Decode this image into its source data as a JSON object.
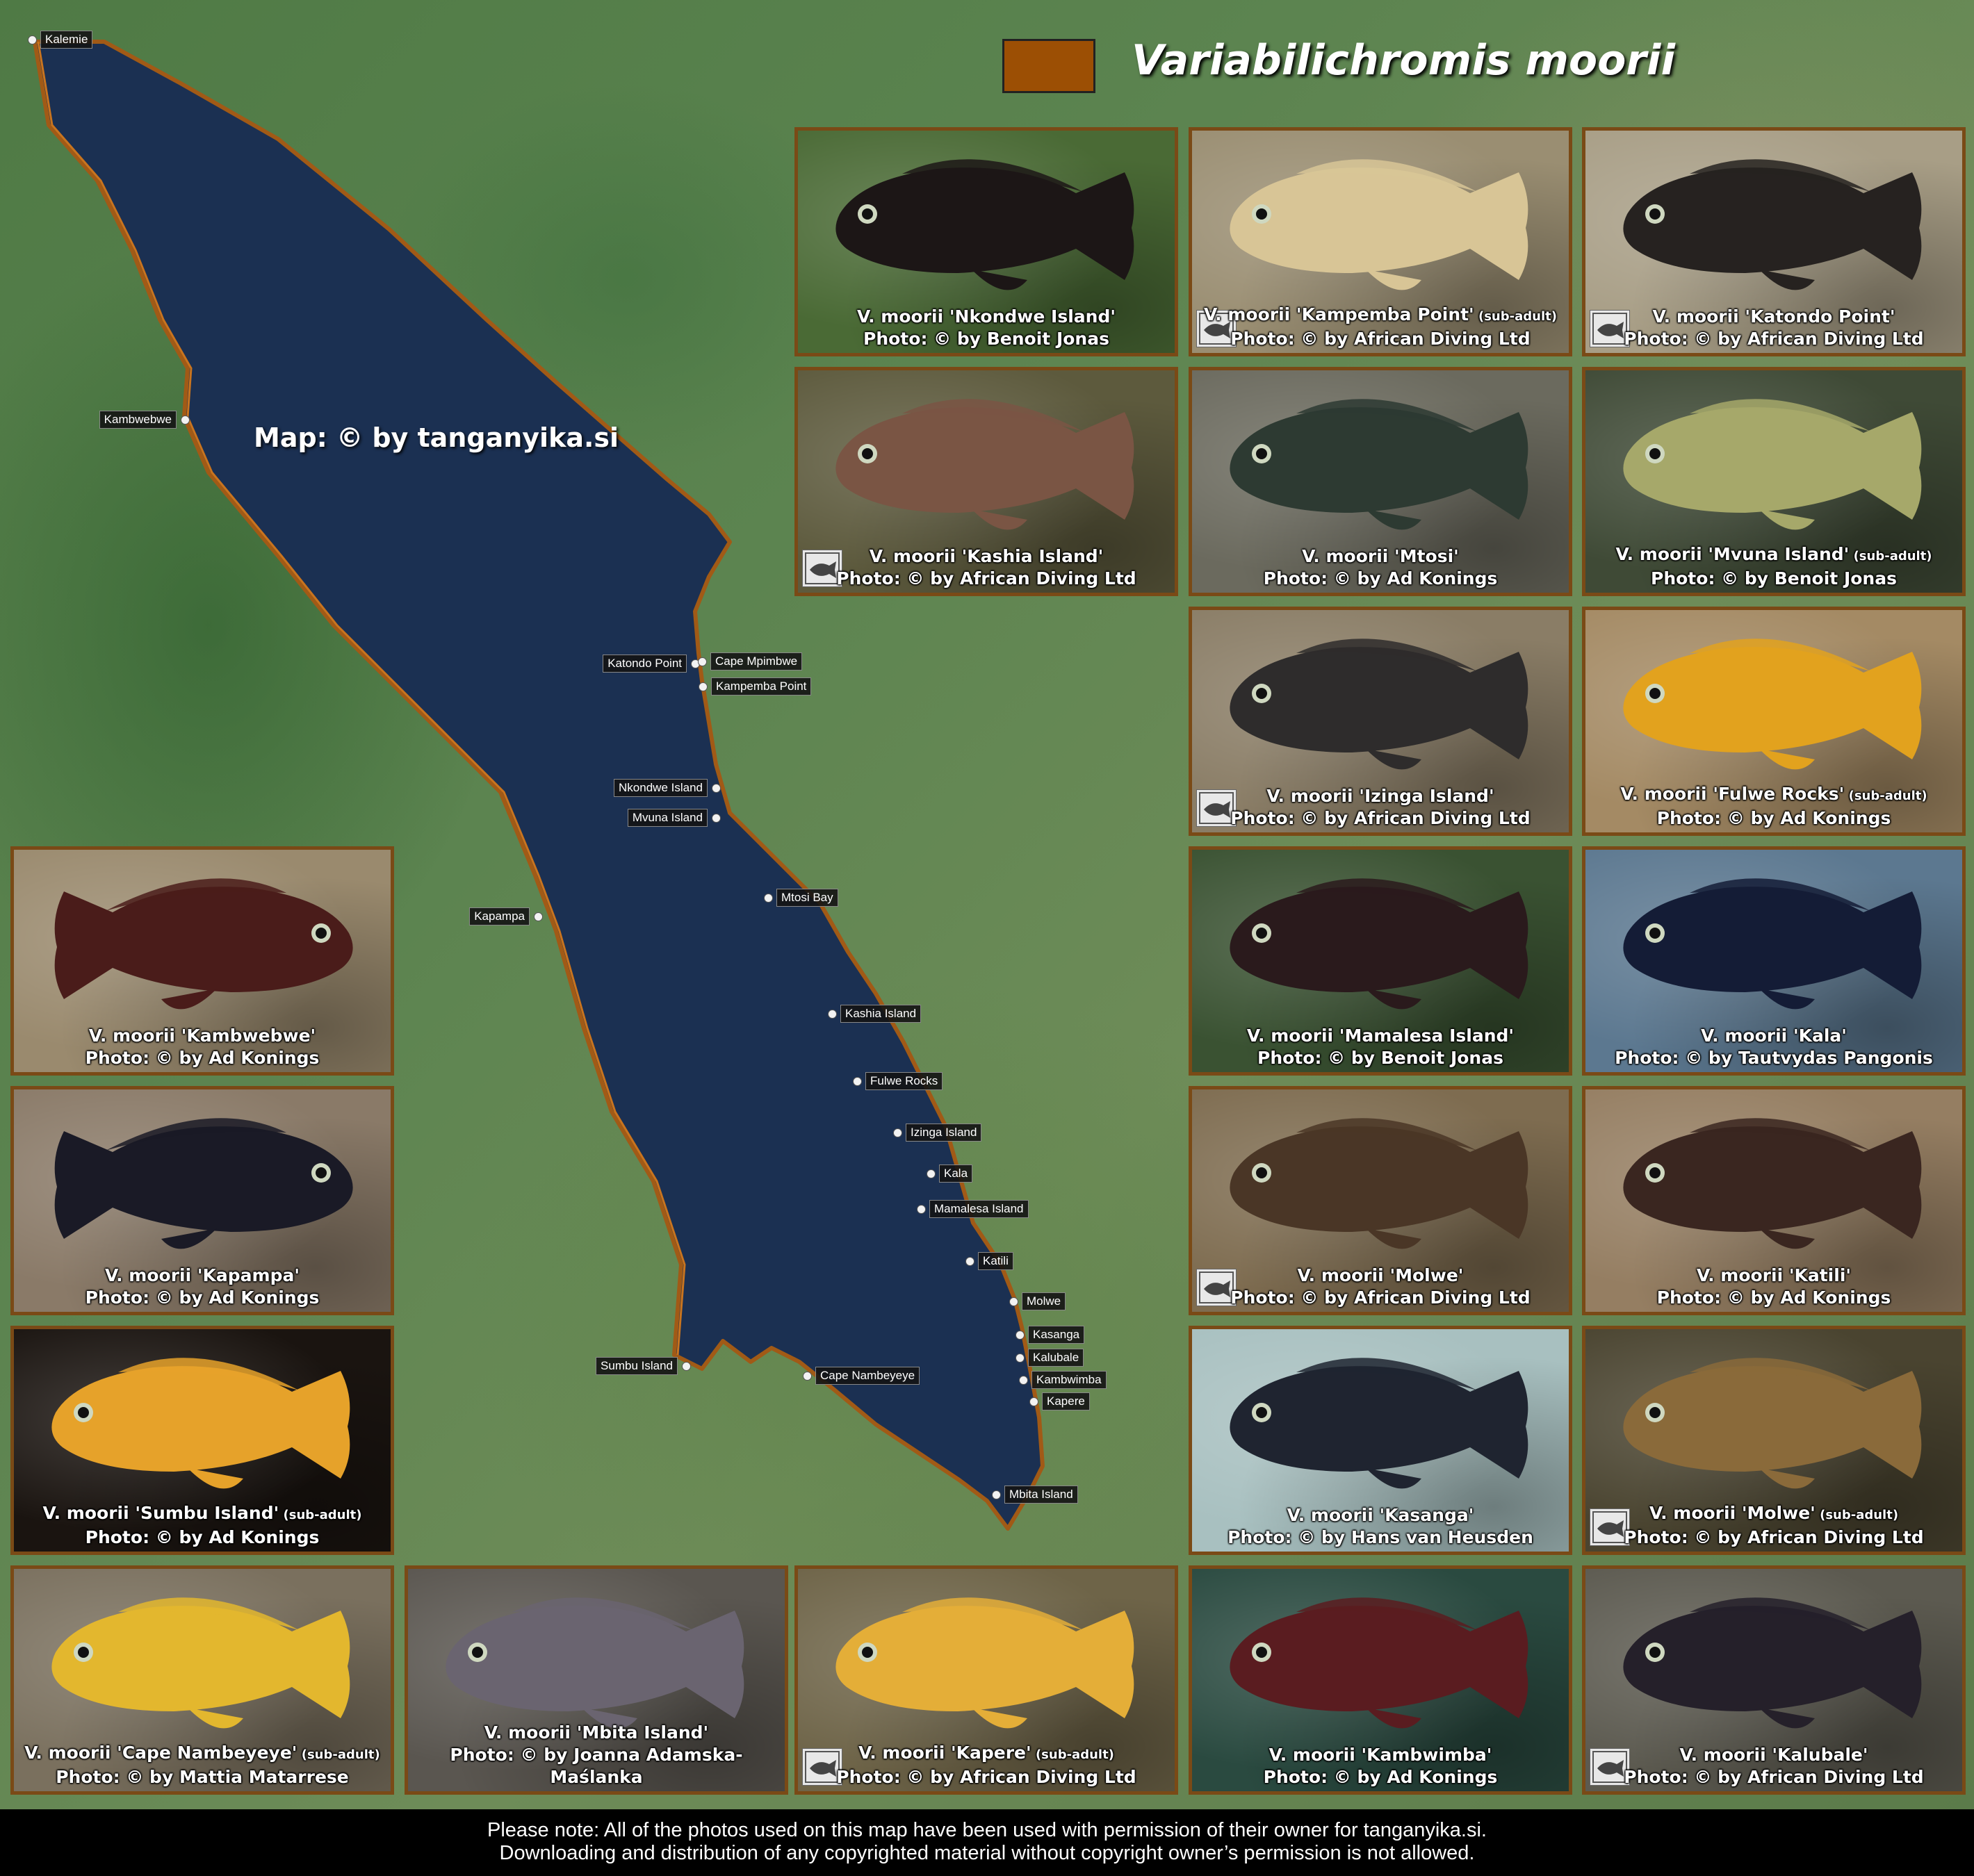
{
  "title": "Variabilichromis moorii",
  "legend_color": "#9c4f04",
  "map_credit": "Map: © by tanganyika.si",
  "localities": [
    {
      "id": "kalemie",
      "label": "Kalemie",
      "side": "right"
    },
    {
      "id": "kambwebwe",
      "label": "Kambwebwe",
      "side": "left"
    },
    {
      "id": "katondo",
      "label": "Katondo Point",
      "side": "left"
    },
    {
      "id": "mpimbwe",
      "label": "Cape Mpimbwe",
      "side": "right"
    },
    {
      "id": "kampemba",
      "label": "Kampemba Point",
      "side": "right"
    },
    {
      "id": "nkondwe",
      "label": "Nkondwe Island",
      "side": "left"
    },
    {
      "id": "mvuna",
      "label": "Mvuna Island",
      "side": "left"
    },
    {
      "id": "mtosi",
      "label": "Mtosi Bay",
      "side": "right"
    },
    {
      "id": "kapampa",
      "label": "Kapampa",
      "side": "left"
    },
    {
      "id": "kashia",
      "label": "Kashia Island",
      "side": "right"
    },
    {
      "id": "fulwe",
      "label": "Fulwe Rocks",
      "side": "right"
    },
    {
      "id": "izinga",
      "label": "Izinga Island",
      "side": "right"
    },
    {
      "id": "kala",
      "label": "Kala",
      "side": "right"
    },
    {
      "id": "mamalesa",
      "label": "Mamalesa Island",
      "side": "right"
    },
    {
      "id": "katili",
      "label": "Katili",
      "side": "right"
    },
    {
      "id": "molwe",
      "label": "Molwe",
      "side": "right"
    },
    {
      "id": "kasanga",
      "label": "Kasanga",
      "side": "right"
    },
    {
      "id": "kalubale",
      "label": "Kalubale",
      "side": "right"
    },
    {
      "id": "kambwimba",
      "label": "Kambwimba",
      "side": "right"
    },
    {
      "id": "kapere",
      "label": "Kapere",
      "side": "right"
    },
    {
      "id": "sumbu",
      "label": "Sumbu Island",
      "side": "left"
    },
    {
      "id": "nambeyeye",
      "label": "Cape Nambeyeye",
      "side": "right"
    },
    {
      "id": "mbita",
      "label": "Mbita Island",
      "side": "right"
    }
  ],
  "photos": [
    {
      "name": "V. moorii 'Nkondwe Island'",
      "sub": "",
      "credit": "Photo: © by Benoit Jonas",
      "bg": "#4a6a35",
      "fish": "#1c1616",
      "badge": false
    },
    {
      "name": "V. moorii 'Kampemba Point'",
      "sub": "(sub-adult)",
      "credit": "Photo: © by African Diving Ltd",
      "bg": "#9a8e72",
      "fish": "#d8c596",
      "badge": true
    },
    {
      "name": "V. moorii 'Katondo Point'",
      "sub": "",
      "credit": "Photo: © by African Diving Ltd",
      "bg": "#a89e86",
      "fish": "#262220",
      "badge": true
    },
    {
      "name": "V. moorii 'Kashia Island'",
      "sub": "",
      "credit": "Photo: © by African Diving Ltd",
      "bg": "#5d5a3d",
      "fish": "#7a5544",
      "badge": true
    },
    {
      "name": "V. moorii 'Mtosi'",
      "sub": "",
      "credit": "Photo: © by Ad Konings",
      "bg": "#6b6a5e",
      "fish": "#2d3a32",
      "badge": false
    },
    {
      "name": "V. moorii 'Mvuna Island'",
      "sub": "(sub-adult)",
      "credit": "Photo: © by Benoit Jonas",
      "bg": "#3f4a36",
      "fish": "#a6a86a",
      "badge": false
    },
    {
      "name": "V. moorii 'Izinga Island'",
      "sub": "",
      "credit": "Photo: © by African Diving Ltd",
      "bg": "#8a7d66",
      "fish": "#2e2c2c",
      "badge": true
    },
    {
      "name": "V. moorii 'Fulwe Rocks'",
      "sub": "(sub-adult)",
      "credit": "Photo: © by Ad Konings",
      "bg": "#a48a64",
      "fish": "#e2a21e",
      "badge": false
    },
    {
      "name": "V. moorii 'Mamalesa Island'",
      "sub": "",
      "credit": "Photo: © by Benoit Jonas",
      "bg": "#3a5232",
      "fish": "#2a1a1c",
      "badge": false
    },
    {
      "name": "V. moorii 'Kala'",
      "sub": "",
      "credit": "Photo: © by Tautvydas Pangonis",
      "bg": "#5c7890",
      "fish": "#141c36",
      "badge": false
    },
    {
      "name": "V. moorii 'Molwe'",
      "sub": "",
      "credit": "Photo: © by African Diving Ltd",
      "bg": "#7e6c50",
      "fish": "#4a3626",
      "badge": true
    },
    {
      "name": "V. moorii 'Katili'",
      "sub": "",
      "credit": "Photo: © by Ad Konings",
      "bg": "#957e62",
      "fish": "#3a2620",
      "badge": false
    },
    {
      "name": "V. moorii 'Kasanga'",
      "sub": "",
      "credit": "Photo: © by Hans van Heusden",
      "bg": "#a8c0c0",
      "fish": "#1f2430",
      "badge": false
    },
    {
      "name": "V. moorii 'Molwe'",
      "sub": "(sub-adult)",
      "credit": "Photo: © by African Diving Ltd",
      "bg": "#4a4430",
      "fish": "#8a6a3a",
      "badge": true
    },
    {
      "name": "V. moorii 'Kambwebwe'",
      "sub": "",
      "credit": "Photo: © by Ad Konings",
      "bg": "#9a8a6e",
      "fish": "#4a1c1a",
      "badge": false
    },
    {
      "name": "V. moorii 'Kapampa'",
      "sub": "",
      "credit": "Photo: © by Ad Konings",
      "bg": "#8a7a68",
      "fish": "#1a1a26",
      "badge": false
    },
    {
      "name": "V. moorii 'Sumbu Island'",
      "sub": "(sub-adult)",
      "credit": "Photo: © by Ad Konings",
      "bg": "#1a1410",
      "fish": "#e6a22a",
      "badge": false
    },
    {
      "name": "V. moorii 'Cape Nambeyeye'",
      "sub": "(sub-adult)",
      "credit": "Photo: © by Mattia Matarrese",
      "bg": "#7a705e",
      "fish": "#e3b72e",
      "badge": false
    },
    {
      "name": "V. moorii 'Mbita Island'",
      "sub": "",
      "credit": "Photo: © by Joanna Adamska-Maślanka",
      "bg": "#5a5650",
      "fish": "#6a6470",
      "badge": false
    },
    {
      "name": "V. moorii 'Kapere'",
      "sub": "(sub-adult)",
      "credit": "Photo: © by African Diving Ltd",
      "bg": "#6e6448",
      "fish": "#e4ae38",
      "badge": true
    },
    {
      "name": "V. moorii 'Kambwimba'",
      "sub": "",
      "credit": "Photo: © by Ad Konings",
      "bg": "#2a4a40",
      "fish": "#5a1c20",
      "badge": false
    },
    {
      "name": "V. moorii 'Kalubale'",
      "sub": "",
      "credit": "Photo: © by African Diving Ltd",
      "bg": "#5c5a50",
      "fish": "#25202a",
      "badge": true
    }
  ],
  "footer": {
    "line1": "Please note: All of the photos used on this map have been used with permission of their owner for tanganyika.si.",
    "line2": "Downloading and distribution of any copyrighted material without copyright owner’s permission is not allowed."
  }
}
